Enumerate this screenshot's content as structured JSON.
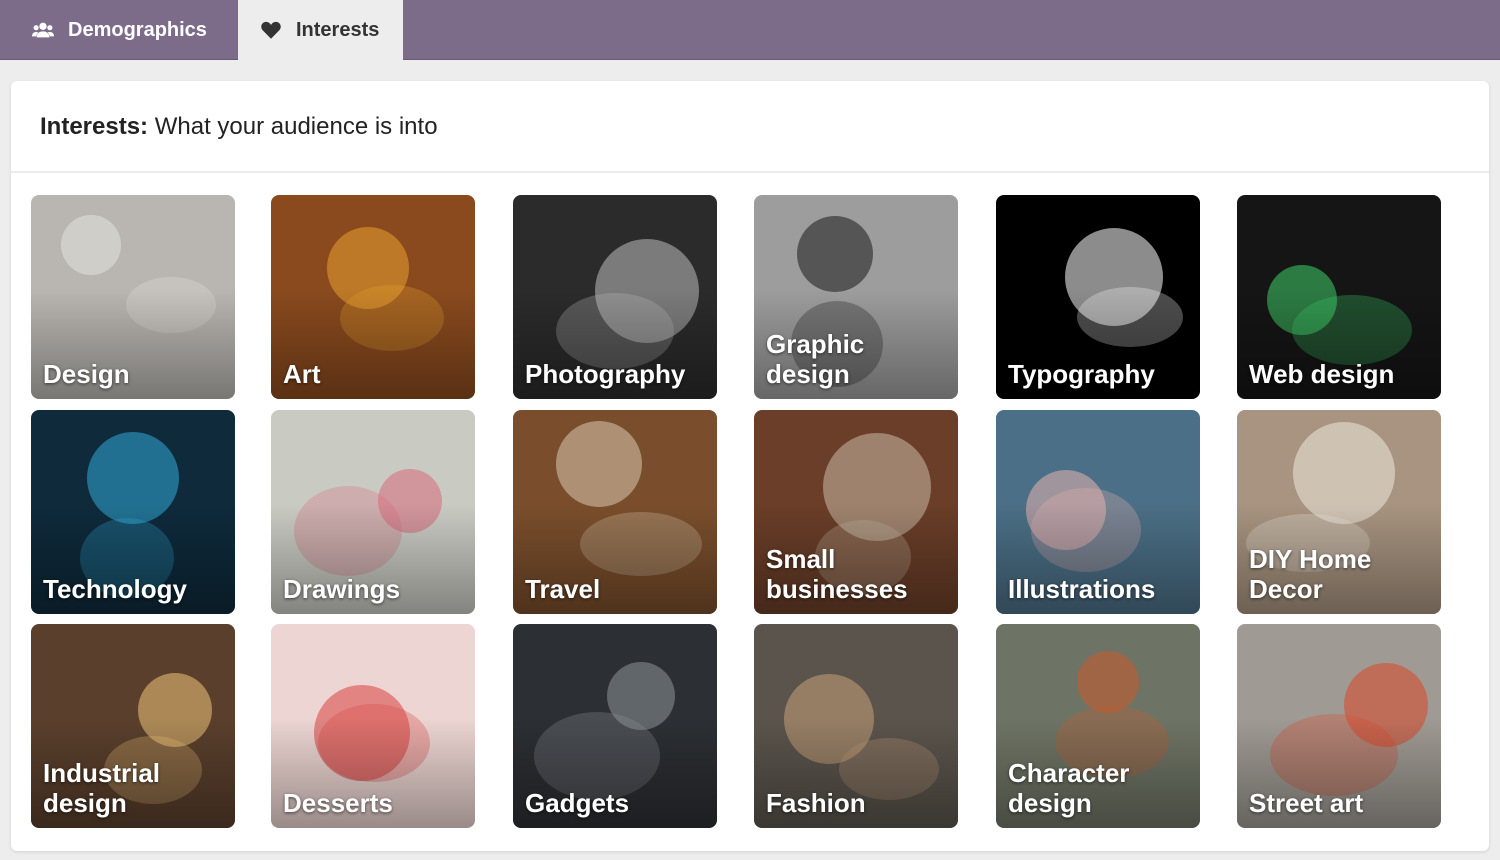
{
  "tabs": [
    {
      "label": "Demographics",
      "icon": "users-icon",
      "active": false
    },
    {
      "label": "Interests",
      "icon": "heart-icon",
      "active": true
    }
  ],
  "section": {
    "title_bold": "Interests:",
    "title_rest": " What your audience is into"
  },
  "interests": [
    {
      "label": "Design",
      "bg": "#b9b6b1",
      "accent": "#e4e2dd"
    },
    {
      "label": "Art",
      "bg": "#8a4a1e",
      "accent": "#e7a12f"
    },
    {
      "label": "Photography",
      "bg": "#2b2b2b",
      "accent": "#bdbdbd"
    },
    {
      "label": "Graphic design",
      "bg": "#9d9d9d",
      "accent": "#1a1a1a"
    },
    {
      "label": "Typography",
      "bg": "#000000",
      "accent": "#ffffff"
    },
    {
      "label": "Web design",
      "bg": "#151515",
      "accent": "#3fd06a"
    },
    {
      "label": "Technology",
      "bg": "#0e2a3b",
      "accent": "#32a9d8"
    },
    {
      "label": "Drawings",
      "bg": "#c9cbc3",
      "accent": "#d76a7c"
    },
    {
      "label": "Travel",
      "bg": "#7a4e2c",
      "accent": "#d8c9b0"
    },
    {
      "label": "Small businesses",
      "bg": "#6a3e28",
      "accent": "#c8b9a5"
    },
    {
      "label": "Illustrations",
      "bg": "#4b6f86",
      "accent": "#e8b2b0"
    },
    {
      "label": "DIY Home Decor",
      "bg": "#a89480",
      "accent": "#ece7dd"
    },
    {
      "label": "Industrial design",
      "bg": "#5a3f2c",
      "accent": "#f1c57a"
    },
    {
      "label": "Desserts",
      "bg": "#ecd5d2",
      "accent": "#d8423f"
    },
    {
      "label": "Gadgets",
      "bg": "#2c2f33",
      "accent": "#8e9399"
    },
    {
      "label": "Fashion",
      "bg": "#5a544c",
      "accent": "#c8a07a"
    },
    {
      "label": "Character design",
      "bg": "#6e7465",
      "accent": "#c95a2c"
    },
    {
      "label": "Street art",
      "bg": "#9f9a93",
      "accent": "#d9482a"
    }
  ]
}
